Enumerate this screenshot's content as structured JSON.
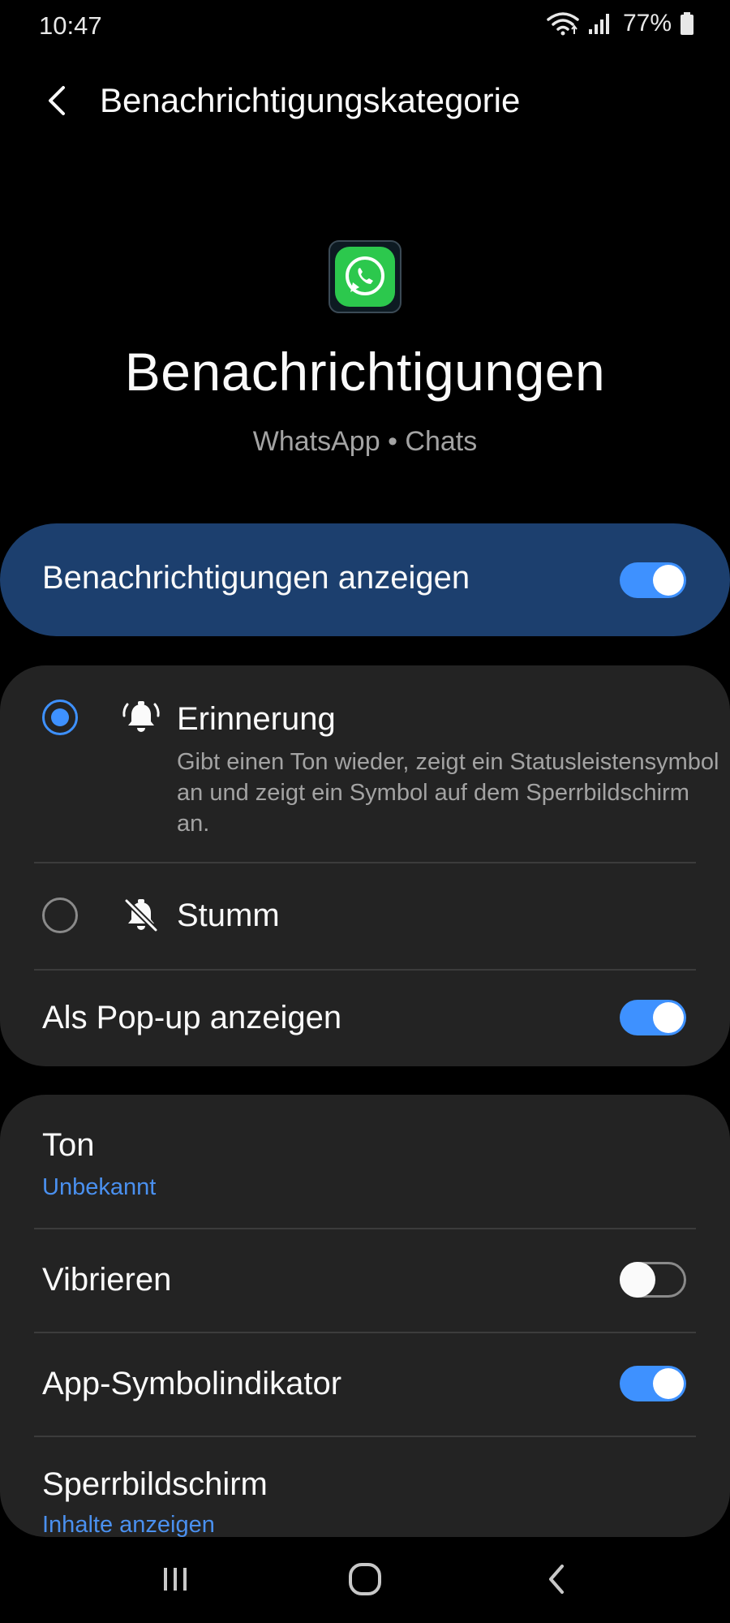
{
  "status_bar": {
    "time": "10:47",
    "battery_percent": "77%"
  },
  "header": {
    "title": "Benachrichtigungskategorie"
  },
  "hero": {
    "title": "Benachrichtigungen",
    "subtitle": "WhatsApp • Chats",
    "app_icon": "whatsapp-icon"
  },
  "master": {
    "label": "Benachrichtigungen anzeigen",
    "enabled": true
  },
  "alert_section": {
    "options": [
      {
        "label": "Erinnerung",
        "description": "Gibt einen Ton wieder, zeigt ein Statusleistensymbol an und zeigt ein Symbol auf dem Sperrbildschirm an.",
        "icon": "bell-ringing-icon",
        "selected": true
      },
      {
        "label": "Stumm",
        "icon": "bell-off-icon",
        "selected": false
      }
    ],
    "popup": {
      "label": "Als Pop-up anzeigen",
      "enabled": true
    }
  },
  "settings": {
    "sound": {
      "label": "Ton",
      "value": "Unbekannt"
    },
    "vibrate": {
      "label": "Vibrieren",
      "enabled": false
    },
    "badge": {
      "label": "App-Symbolindikator",
      "enabled": true
    },
    "lockscreen": {
      "label": "Sperrbildschirm",
      "value": "Inhalte anzeigen"
    }
  },
  "colors": {
    "accent": "#3e91ff",
    "master_card": "#1c3f6e",
    "card": "#232323",
    "link": "#4a90ef"
  }
}
